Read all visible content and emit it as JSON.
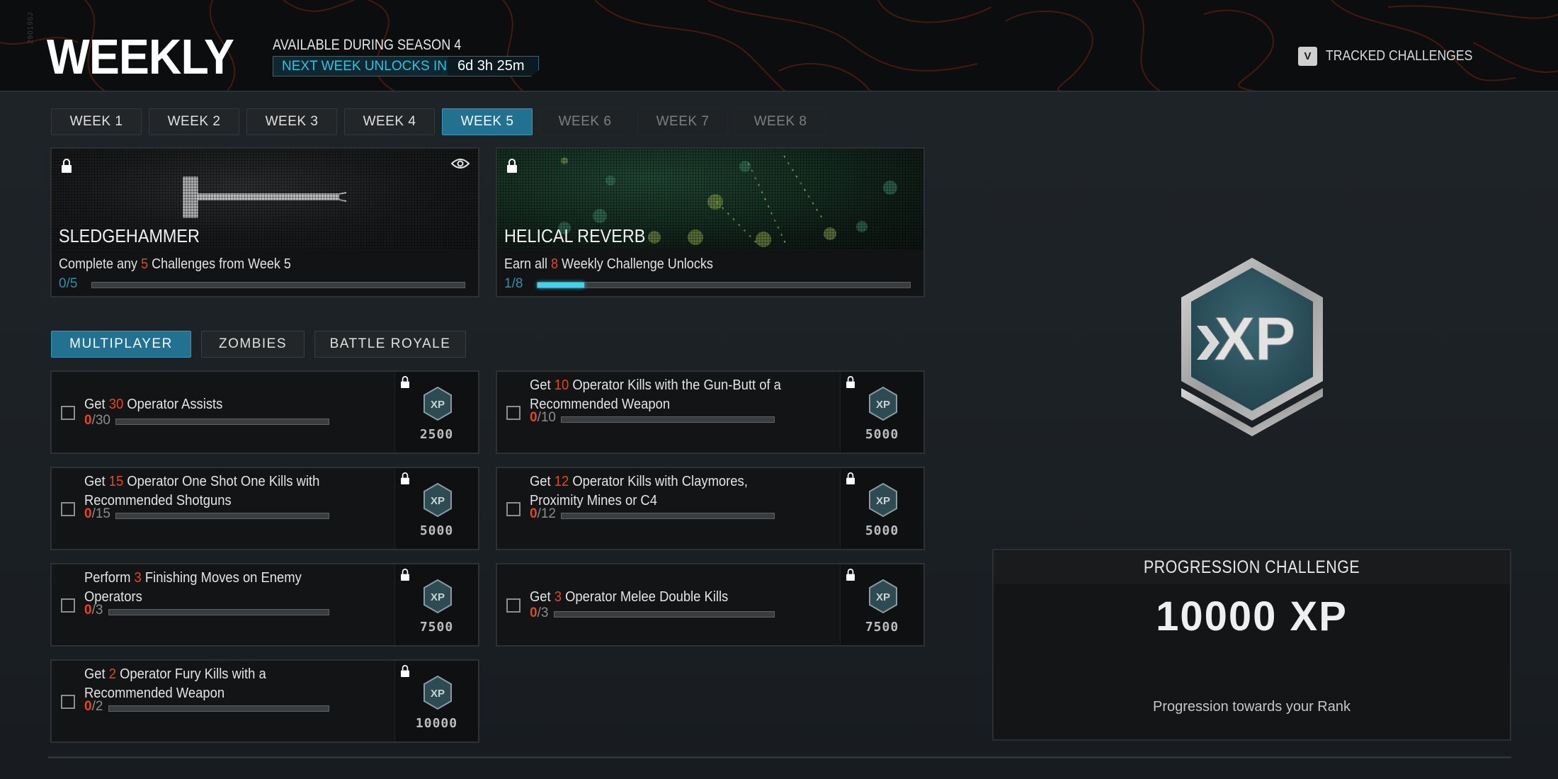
{
  "header": {
    "serial": "290195J",
    "title": "WEEKLY",
    "season_label": "AVAILABLE DURING SEASON 4",
    "next_unlock_label": "NEXT WEEK UNLOCKS IN",
    "next_unlock_time": "6d 3h 25m",
    "tracked_key": "V",
    "tracked_label": "TRACKED CHALLENGES"
  },
  "week_tabs": [
    {
      "label": "WEEK 1",
      "state": "available"
    },
    {
      "label": "WEEK 2",
      "state": "available"
    },
    {
      "label": "WEEK 3",
      "state": "available"
    },
    {
      "label": "WEEK 4",
      "state": "available"
    },
    {
      "label": "WEEK 5",
      "state": "active"
    },
    {
      "label": "WEEK 6",
      "state": "locked"
    },
    {
      "label": "WEEK 7",
      "state": "locked"
    },
    {
      "label": "WEEK 8",
      "state": "locked"
    }
  ],
  "rewards": [
    {
      "name": "SLEDGEHAMMER",
      "desc_pre": "Complete any ",
      "desc_num": "5",
      "desc_post": " Challenges from Week 5",
      "current": "0",
      "total": "5",
      "progress": 0,
      "has_preview": true
    },
    {
      "name": "HELICAL REVERB",
      "desc_pre": "Earn all ",
      "desc_num": "8",
      "desc_post": " Weekly Challenge Unlocks",
      "current": "1",
      "total": "8",
      "progress": 0.125,
      "has_preview": false
    }
  ],
  "mode_tabs": [
    {
      "label": "MULTIPLAYER",
      "active": true
    },
    {
      "label": "ZOMBIES",
      "active": false
    },
    {
      "label": "BATTLE ROYALE",
      "active": false
    }
  ],
  "challenges": [
    {
      "pre": "Get ",
      "num": "30",
      "post": " Operator Assists",
      "current": "0",
      "total": "30",
      "xp": "2500"
    },
    {
      "pre": "Get ",
      "num": "10",
      "post": " Operator Kills with the Gun-Butt of a Recommended Weapon",
      "current": "0",
      "total": "10",
      "xp": "5000"
    },
    {
      "pre": "Get ",
      "num": "15",
      "post": " Operator One Shot One Kills with Recommended Shotguns",
      "current": "0",
      "total": "15",
      "xp": "5000"
    },
    {
      "pre": "Get ",
      "num": "12",
      "post": " Operator Kills with Claymores, Proximity Mines or C4",
      "current": "0",
      "total": "12",
      "xp": "5000"
    },
    {
      "pre": "Perform ",
      "num": "3",
      "post": " Finishing Moves on Enemy Operators",
      "current": "0",
      "total": "3",
      "xp": "7500"
    },
    {
      "pre": "Get ",
      "num": "3",
      "post": " Operator Melee Double Kills",
      "current": "0",
      "total": "3",
      "xp": "7500"
    },
    {
      "pre": "Get ",
      "num": "2",
      "post": " Operator Fury Kills with a Recommended Weapon",
      "current": "0",
      "total": "2",
      "xp": "10000"
    }
  ],
  "progression": {
    "title": "PROGRESSION CHALLENGE",
    "xp": "10000 XP",
    "subtitle": "Progression towards your Rank"
  },
  "colors": {
    "accent_blue": "#237191",
    "highlight_orange": "#e4471f",
    "progress_cyan": "#3ad5f2"
  }
}
